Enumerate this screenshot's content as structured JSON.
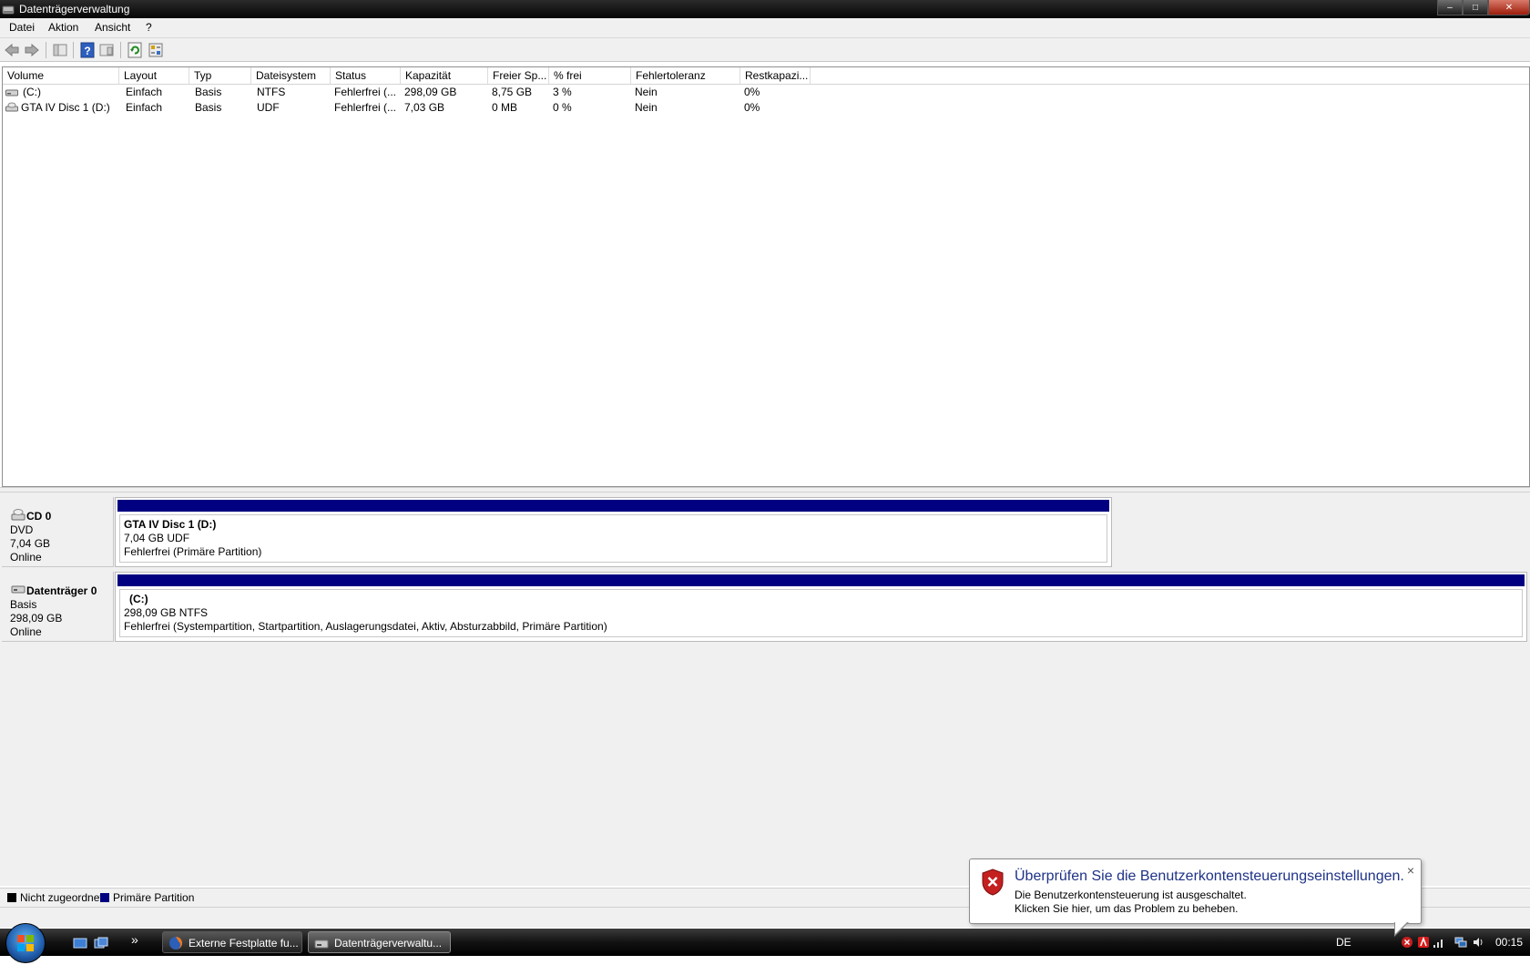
{
  "window": {
    "title": "Datenträgerverwaltung",
    "minimize": "–",
    "maximize": "□",
    "close": "✕"
  },
  "menu": [
    "Datei",
    "Aktion",
    "Ansicht",
    "?"
  ],
  "columns": [
    "Volume",
    "Layout",
    "Typ",
    "Dateisystem",
    "Status",
    "Kapazität",
    "Freier Sp...",
    "% frei",
    "Fehlertoleranz",
    "Restkapazi..."
  ],
  "volumes": [
    {
      "volume": "(C:)",
      "layout": "Einfach",
      "typ": "Basis",
      "fs": "NTFS",
      "status": "Fehlerfrei (...",
      "kap": "298,09 GB",
      "frei": "8,75 GB",
      "pct": "3 %",
      "ft": "Nein",
      "rest": "0%"
    },
    {
      "volume": "GTA IV Disc 1 (D:)",
      "layout": "Einfach",
      "typ": "Basis",
      "fs": "UDF",
      "status": "Fehlerfrei (...",
      "kap": "7,03 GB",
      "frei": "0 MB",
      "pct": "0 %",
      "ft": "Nein",
      "rest": "0%"
    }
  ],
  "disks": [
    {
      "name": "CD 0",
      "type": "DVD",
      "size": "7,04 GB",
      "state": "Online",
      "partition": {
        "title": "GTA IV Disc 1  (D:)",
        "size": "7,04 GB UDF",
        "status": "Fehlerfrei (Primäre Partition)"
      }
    },
    {
      "name": "Datenträger 0",
      "type": "Basis",
      "size": "298,09 GB",
      "state": "Online",
      "partition": {
        "title": "(C:)",
        "size": "298,09 GB NTFS",
        "status": "Fehlerfrei (Systempartition, Startpartition, Auslagerungsdatei, Aktiv, Absturzabbild, Primäre Partition)"
      }
    }
  ],
  "legend": [
    {
      "label": "Nicht zugeordnet",
      "color": "#000000"
    },
    {
      "label": "Primäre Partition",
      "color": "#000080"
    }
  ],
  "balloon": {
    "title": "Überprüfen Sie die Benutzerkontensteuerungseinstellungen.",
    "line1": "Die Benutzerkontensteuerung ist ausgeschaltet.",
    "line2": "Klicken Sie hier, um das Problem zu beheben.",
    "close": "×"
  },
  "taskbar": {
    "buttons": [
      "Externe Festplatte fu...",
      "Datenträgerverwaltu..."
    ],
    "chevron": "»",
    "lang": "DE",
    "clock": "00:15"
  }
}
